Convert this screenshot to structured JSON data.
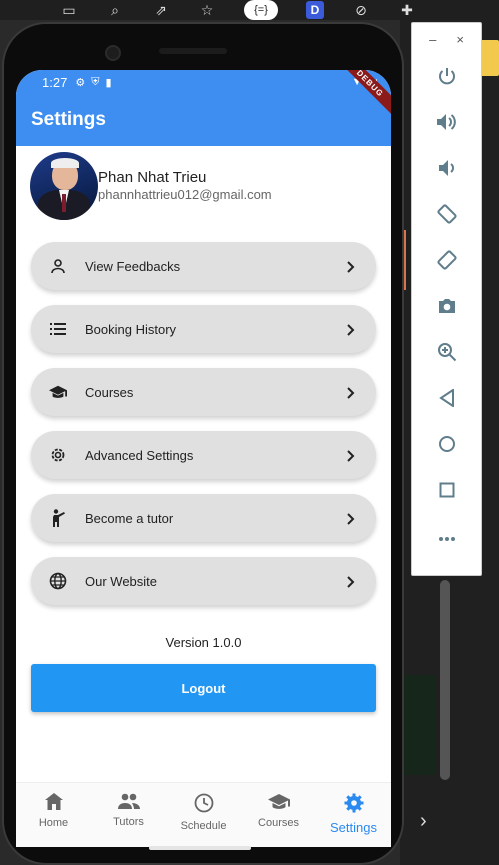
{
  "status_bar": {
    "time": "1:27",
    "debug_label": "DEBUG"
  },
  "app_bar": {
    "title": "Settings"
  },
  "profile": {
    "name": "Phan Nhat Trieu",
    "email": "phannhattrieu012@gmail.com"
  },
  "menu": {
    "items": [
      {
        "label": "View Feedbacks",
        "icon": "person-icon"
      },
      {
        "label": "Booking History",
        "icon": "list-icon"
      },
      {
        "label": "Courses",
        "icon": "graduation-cap-icon"
      },
      {
        "label": "Advanced Settings",
        "icon": "gear-icon"
      },
      {
        "label": "Become a tutor",
        "icon": "teacher-icon"
      },
      {
        "label": "Our Website",
        "icon": "globe-icon"
      }
    ]
  },
  "version": "Version 1.0.0",
  "logout_label": "Logout",
  "bottom_nav": {
    "items": [
      {
        "label": "Home",
        "icon": "home-icon"
      },
      {
        "label": "Tutors",
        "icon": "people-icon"
      },
      {
        "label": "Schedule",
        "icon": "clock-icon"
      },
      {
        "label": "Courses",
        "icon": "school-icon"
      },
      {
        "label": "Settings",
        "icon": "settings-icon"
      }
    ],
    "active": "Settings"
  },
  "emulator_panel": {
    "buttons": [
      "power-icon",
      "volume-up-icon",
      "volume-down-icon",
      "rotate-left-icon",
      "rotate-right-icon",
      "camera-icon",
      "zoom-icon",
      "back-icon",
      "home-circle-icon",
      "overview-icon",
      "more-icon"
    ]
  },
  "colors": {
    "primary": "#3d8ef0",
    "logout": "#2196f3",
    "menu_bg": "#e0e0e0",
    "nav_active": "#2b8af0"
  }
}
